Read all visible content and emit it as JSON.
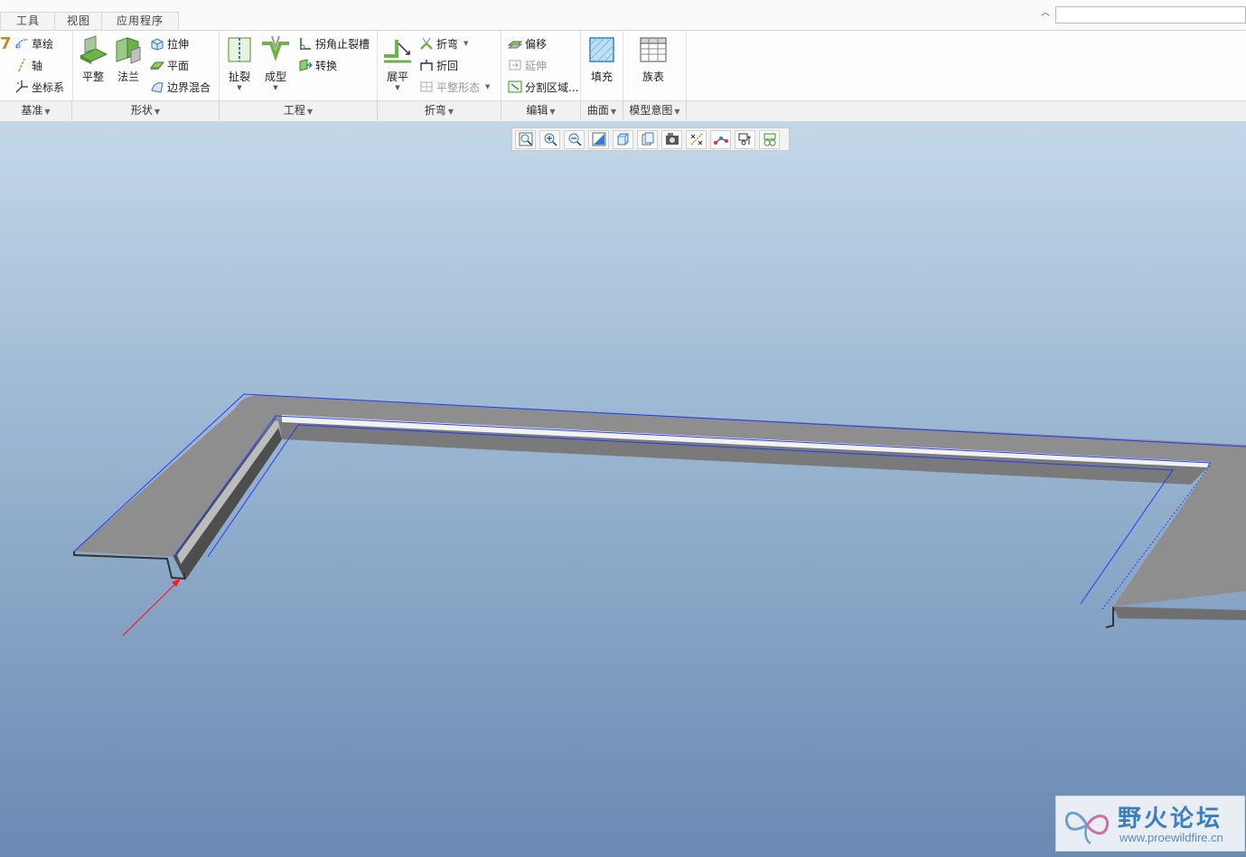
{
  "tabs": [
    {
      "label": "工具"
    },
    {
      "label": "视图"
    },
    {
      "label": "应用程序"
    }
  ],
  "search": {
    "placeholder": ""
  },
  "ribbon": {
    "datum": {
      "items": [
        "草绘",
        "轴",
        "坐标系"
      ],
      "group": "基准"
    },
    "shapes": {
      "big": [
        "平整",
        "法兰"
      ],
      "items": [
        "拉伸",
        "平面",
        "边界混合"
      ],
      "group": "形状"
    },
    "engineering": {
      "big": [
        "扯裂",
        "成型"
      ],
      "items": [
        "拐角止裂槽",
        "转换"
      ],
      "group": "工程"
    },
    "bend": {
      "big": [
        "展平"
      ],
      "items": [
        "折弯",
        "折回",
        "平整形态"
      ],
      "group": "折弯"
    },
    "edit": {
      "items": [
        "偏移",
        "延伸",
        "分割区域..."
      ],
      "big": [
        "填充"
      ],
      "group": "编辑"
    },
    "surface": {
      "group": "曲面"
    },
    "intent": {
      "big": [
        "族表"
      ],
      "group": "模型意图"
    }
  },
  "view_toolbar": {
    "icons": [
      "refit-icon",
      "zoom-in-icon",
      "zoom-out-icon",
      "repaint-icon",
      "display-style-icon",
      "saved-orientations-icon",
      "view-manager-icon",
      "datum-display-icon",
      "spin-center-icon",
      "annotation-display-icon",
      "simplified-rep-icon"
    ]
  },
  "watermark": {
    "title": "野火论坛",
    "url": "www.proewildfire.cn"
  },
  "colors": {
    "accent": "#3b7fc0",
    "model_edge": "#1f3cff",
    "arrow": "#ff1a1a"
  }
}
